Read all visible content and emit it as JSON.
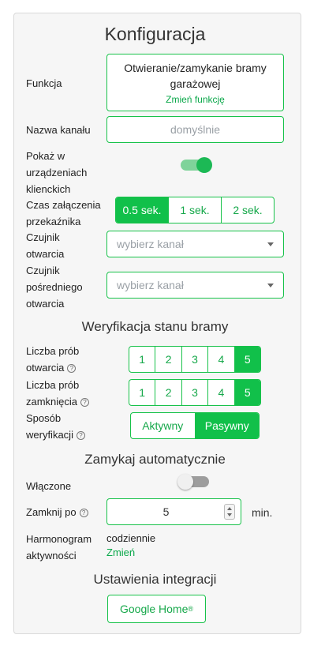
{
  "title": "Konfiguracja",
  "function": {
    "label": "Funkcja",
    "value": "Otwieranie/zamykanie bramy garażowej",
    "change_link": "Zmień funkcję"
  },
  "channel_name": {
    "label": "Nazwa kanału",
    "placeholder": "domyślnie"
  },
  "show_in_clients": {
    "label": "Pokaż w urządzeniach klienckich",
    "on": true
  },
  "relay_time": {
    "label": "Czas załączenia przekaźnika",
    "options": [
      "0.5 sek.",
      "1 sek.",
      "2 sek."
    ],
    "selected": "0.5 sek."
  },
  "open_sensor": {
    "label": "Czujnik otwarcia",
    "placeholder": "wybierz kanał"
  },
  "partial_open_sensor": {
    "label": "Czujnik pośredniego otwarcia",
    "placeholder": "wybierz kanał"
  },
  "verification_section": {
    "title": "Weryfikacja stanu bramy",
    "open_attempts": {
      "label": "Liczba prób otwarcia",
      "options": [
        "1",
        "2",
        "3",
        "4",
        "5"
      ],
      "selected": "5"
    },
    "close_attempts": {
      "label": "Liczba prób zamknięcia",
      "options": [
        "1",
        "2",
        "3",
        "4",
        "5"
      ],
      "selected": "5"
    },
    "method": {
      "label": "Sposób weryfikacji",
      "options": [
        "Aktywny",
        "Pasywny"
      ],
      "selected": "Pasywny"
    }
  },
  "auto_close_section": {
    "title": "Zamykaj automatycznie",
    "enabled": {
      "label": "Włączone",
      "on": false
    },
    "close_after": {
      "label": "Zamknij po",
      "value": "5",
      "unit": "min."
    },
    "schedule": {
      "label": "Harmonogram aktywności",
      "value": "codziennie",
      "link": "Zmień"
    }
  },
  "integrations_section": {
    "title": "Ustawienia integracji",
    "google_home": {
      "label": "Google Home",
      "mark": "®"
    }
  },
  "colors": {
    "accent": "#11c04a",
    "panel_bg": "#f6f6f6",
    "link": "#0aa84a"
  },
  "icons": {
    "help": "question-circle-icon",
    "dropdown": "chevron-down-icon",
    "spinner": "stepper-icon"
  }
}
